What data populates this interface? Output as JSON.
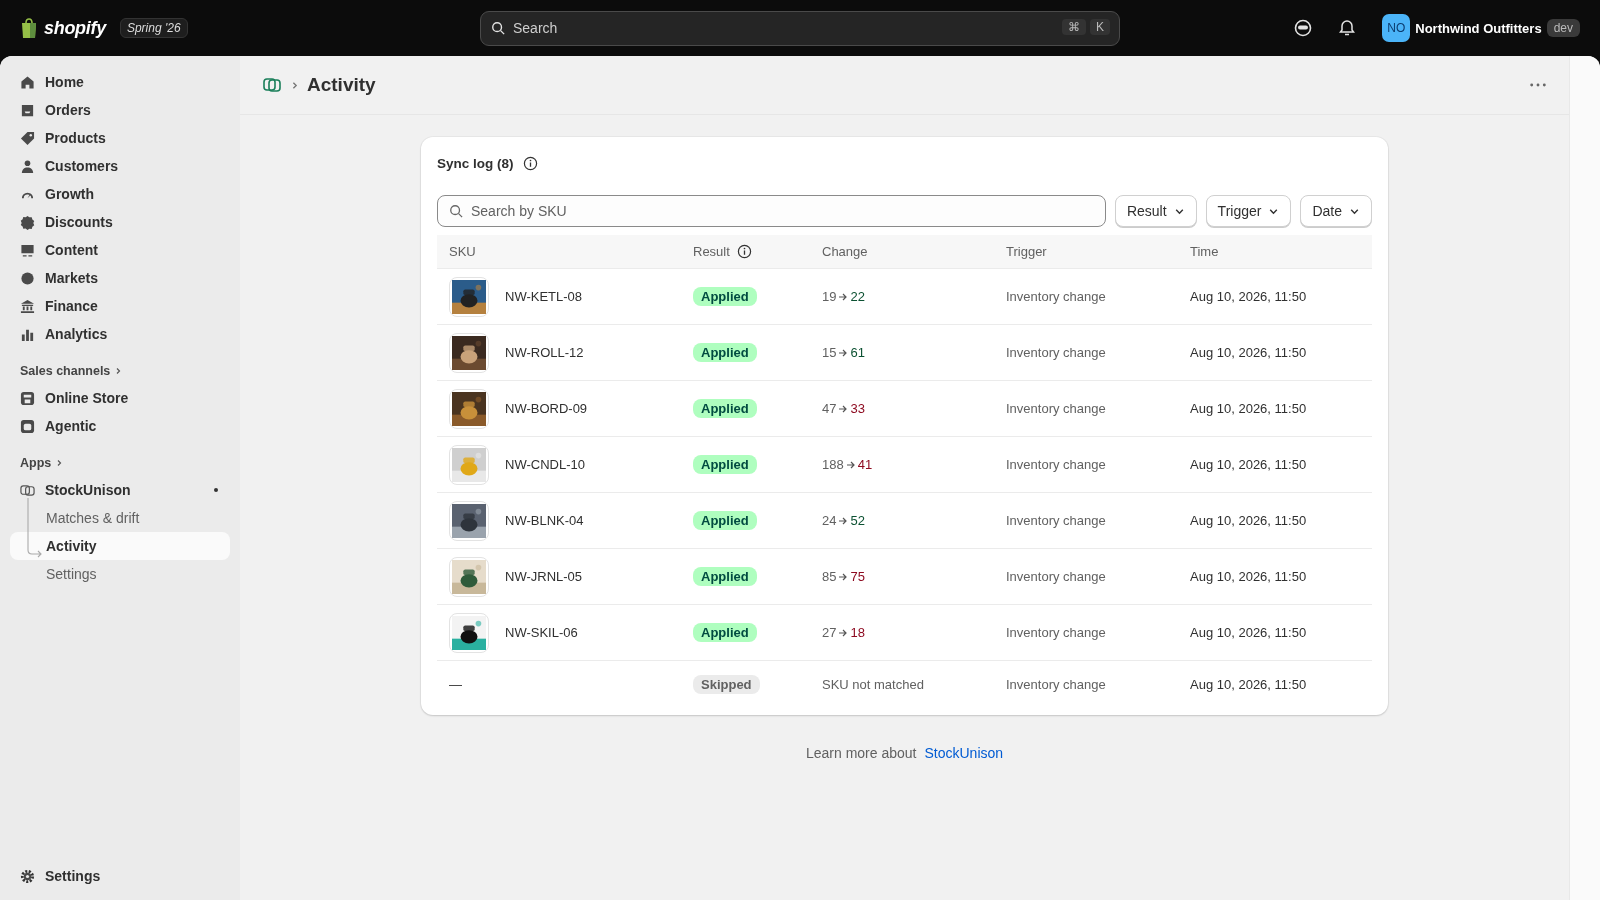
{
  "topbar": {
    "brand": "shopify",
    "edition": "Spring '26",
    "search": {
      "placeholder": "Search"
    },
    "shortcut": [
      "⌘",
      "K"
    ],
    "store": {
      "initials": "NO",
      "name": "Northwind Outfitters",
      "badge": "dev"
    }
  },
  "sidebar": {
    "items": [
      {
        "label": "Home",
        "selected": false
      },
      {
        "label": "Orders",
        "selected": false
      },
      {
        "label": "Products",
        "selected": false
      },
      {
        "label": "Customers",
        "selected": false
      },
      {
        "label": "Growth",
        "selected": false
      },
      {
        "label": "Discounts",
        "selected": false
      },
      {
        "label": "Content",
        "selected": false
      },
      {
        "label": "Markets",
        "selected": false
      },
      {
        "label": "Finance",
        "selected": false
      },
      {
        "label": "Analytics",
        "selected": false
      }
    ],
    "sales_channels": {
      "title": "Sales channels",
      "items": [
        {
          "label": "Online Store",
          "selected": false
        },
        {
          "label": "Agentic",
          "selected": false
        }
      ]
    },
    "apps": {
      "title": "Apps",
      "items": [
        {
          "label": "StockUnison",
          "unread": true,
          "children": [
            {
              "label": "Matches & drift",
              "selected": false
            },
            {
              "label": "Activity",
              "selected": true
            },
            {
              "label": "Settings",
              "selected": false
            }
          ]
        }
      ]
    },
    "footer": {
      "label": "Settings"
    }
  },
  "page": {
    "title": "Activity"
  },
  "card": {
    "title": "Sync log (8)",
    "info": true,
    "search": {
      "placeholder": "Search by SKU"
    },
    "filters": [
      "Result",
      "Trigger",
      "Date"
    ],
    "table": {
      "columns": [
        {
          "label": "SKU",
          "info": false
        },
        {
          "label": "Result",
          "info": true
        },
        {
          "label": "Change",
          "info": false
        },
        {
          "label": "Trigger",
          "info": false
        },
        {
          "label": "Time",
          "info": false
        }
      ],
      "rows": [
        {
          "sku": "NW-KETL-08",
          "result": {
            "label": "Applied",
            "kind": "applied"
          },
          "change": {
            "kind": "delta",
            "from": "19",
            "to": "22",
            "color": "#0c5132"
          },
          "trigger": "Inventory change",
          "time": "Aug 10, 2026, 11:50"
        },
        {
          "sku": "NW-ROLL-12",
          "result": {
            "label": "Applied",
            "kind": "applied"
          },
          "change": {
            "kind": "delta",
            "from": "15",
            "to": "61",
            "color": "#0c5132"
          },
          "trigger": "Inventory change",
          "time": "Aug 10, 2026, 11:50"
        },
        {
          "sku": "NW-BORD-09",
          "result": {
            "label": "Applied",
            "kind": "applied"
          },
          "change": {
            "kind": "delta",
            "from": "47",
            "to": "33",
            "color": "#8e0b21"
          },
          "trigger": "Inventory change",
          "time": "Aug 10, 2026, 11:50"
        },
        {
          "sku": "NW-CNDL-10",
          "result": {
            "label": "Applied",
            "kind": "applied"
          },
          "change": {
            "kind": "delta",
            "from": "188",
            "to": "41",
            "color": "#8e0b21"
          },
          "trigger": "Inventory change",
          "time": "Aug 10, 2026, 11:50"
        },
        {
          "sku": "NW-BLNK-04",
          "result": {
            "label": "Applied",
            "kind": "applied"
          },
          "change": {
            "kind": "delta",
            "from": "24",
            "to": "52",
            "color": "#0c5132"
          },
          "trigger": "Inventory change",
          "time": "Aug 10, 2026, 11:50"
        },
        {
          "sku": "NW-JRNL-05",
          "result": {
            "label": "Applied",
            "kind": "applied"
          },
          "change": {
            "kind": "delta",
            "from": "85",
            "to": "75",
            "color": "#8e0b21"
          },
          "trigger": "Inventory change",
          "time": "Aug 10, 2026, 11:50"
        },
        {
          "sku": "NW-SKIL-06",
          "result": {
            "label": "Applied",
            "kind": "applied"
          },
          "change": {
            "kind": "delta",
            "from": "27",
            "to": "18",
            "color": "#8e0b21"
          },
          "trigger": "Inventory change",
          "time": "Aug 10, 2026, 11:50"
        },
        {
          "sku": "—",
          "result": {
            "label": "Skipped",
            "kind": "skipped"
          },
          "change": {
            "kind": "note",
            "text": "SKU not matched"
          },
          "trigger": "Inventory change",
          "time": "Aug 10, 2026, 11:50"
        }
      ]
    }
  },
  "footer": {
    "text": "Learn more about",
    "link": "StockUnison"
  }
}
